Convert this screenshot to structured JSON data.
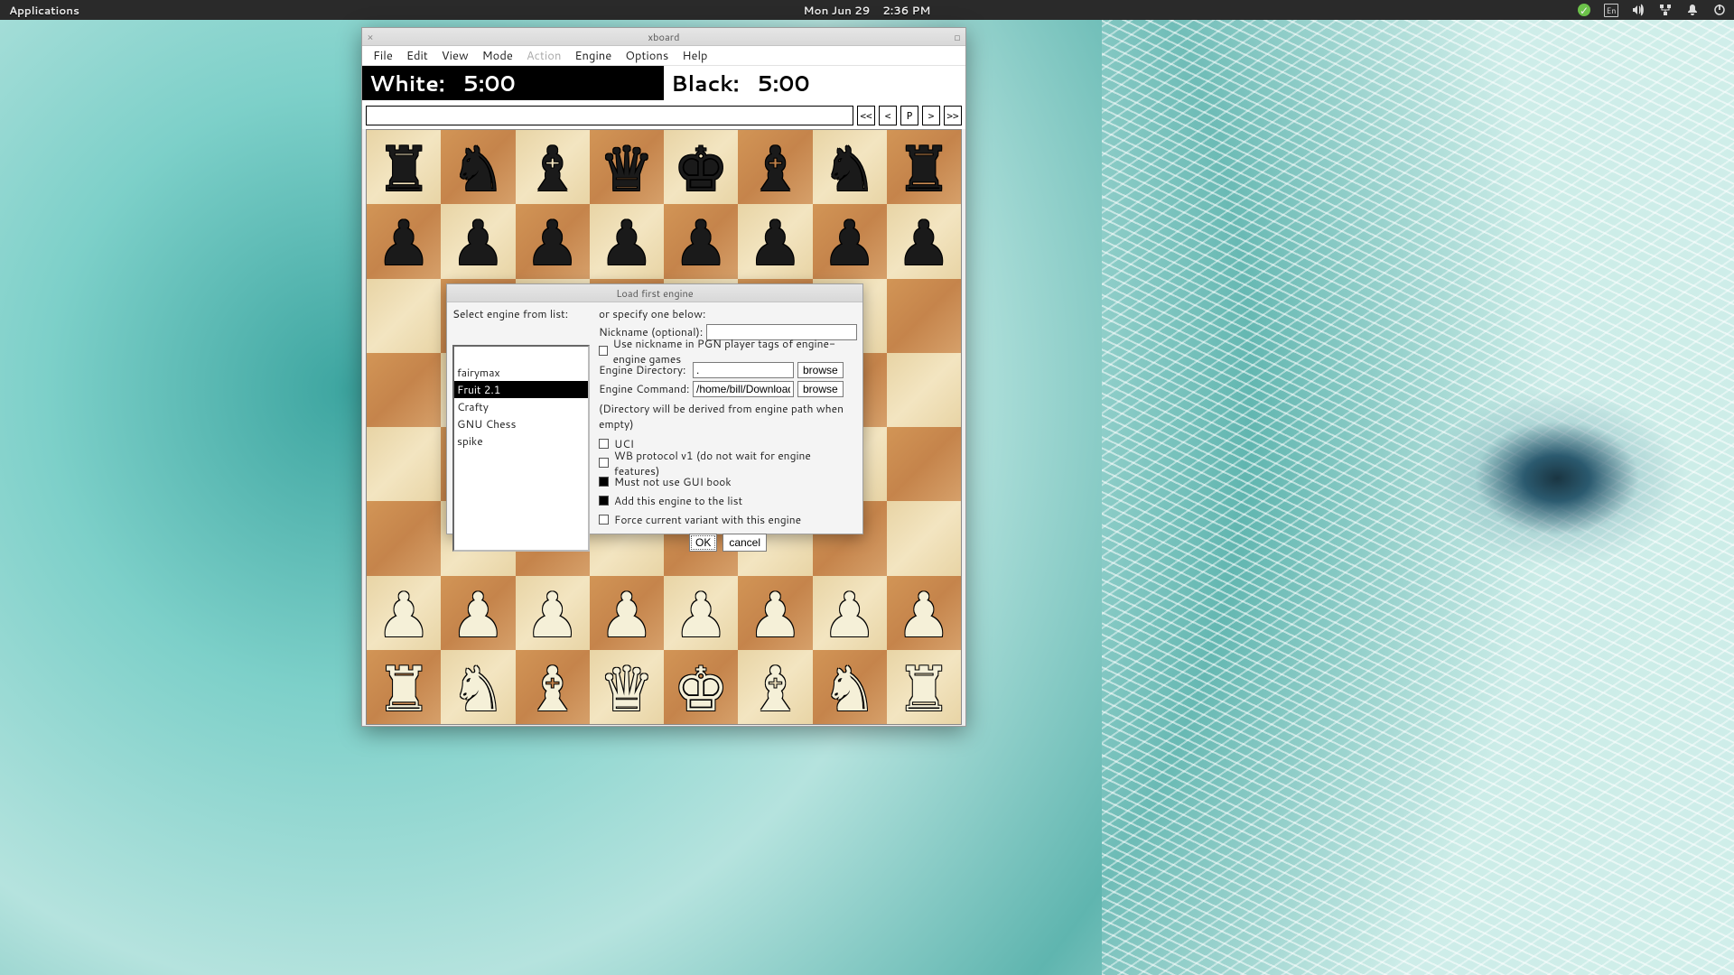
{
  "topbar": {
    "apps": "Applications",
    "date": "Mon Jun 29",
    "time": "2:36 PM",
    "lang": "En"
  },
  "xboard": {
    "title": "xboard",
    "menus": [
      "File",
      "Edit",
      "View",
      "Mode",
      "Action",
      "Engine",
      "Options",
      "Help"
    ],
    "menu_disabled_index": 4,
    "clock_white_label": "White:",
    "clock_white_time": "5:00",
    "clock_black_label": "Black:",
    "clock_black_time": "5:00",
    "nav": [
      "<<",
      "<",
      "P",
      ">",
      ">>"
    ]
  },
  "board": {
    "rows": [
      [
        "bR",
        "bN",
        "bB",
        "bQ",
        "bK",
        "bB",
        "bN",
        "bR"
      ],
      [
        "bP",
        "bP",
        "bP",
        "bP",
        "bP",
        "bP",
        "bP",
        "bP"
      ],
      [
        "",
        "",
        "",
        "",
        "",
        "",
        "",
        ""
      ],
      [
        "",
        "",
        "",
        "",
        "",
        "",
        "",
        ""
      ],
      [
        "",
        "",
        "",
        "",
        "",
        "",
        "",
        ""
      ],
      [
        "",
        "",
        "",
        "",
        "",
        "",
        "",
        ""
      ],
      [
        "wP",
        "wP",
        "wP",
        "wP",
        "wP",
        "wP",
        "wP",
        "wP"
      ],
      [
        "wR",
        "wN",
        "wB",
        "wQ",
        "wK",
        "wB",
        "wN",
        "wR"
      ]
    ],
    "glyphs": {
      "K": "♚",
      "Q": "♛",
      "R": "♜",
      "B": "♝",
      "N": "♞",
      "P": "♟"
    }
  },
  "dialog": {
    "title": "Load first engine",
    "left_label": "Select engine from list:",
    "engines": [
      "fairymax",
      "Fruit 2.1",
      "Crafty",
      "GNU Chess",
      "spike"
    ],
    "selected_engine_index": 1,
    "right_label": "or specify one below:",
    "nickname_label": "Nickname (optional):",
    "nickname_value": "",
    "use_nick_label": "Use nickname in PGN player tags of engine-engine games",
    "use_nick_checked": false,
    "dir_label": "Engine Directory:",
    "dir_value": ".",
    "cmd_label": "Engine Command:",
    "cmd_value": "/home/bill/Downloads/s",
    "browse": "browse",
    "dir_note": "(Directory will be derived from engine path when empty)",
    "uci_label": "UCI",
    "uci_checked": false,
    "wbv1_label": "WB protocol v1 (do not wait for engine features)",
    "wbv1_checked": false,
    "nogui_label": "Must not use GUI book",
    "nogui_checked": true,
    "addlist_label": "Add this engine to the list",
    "addlist_checked": true,
    "forcevar_label": "Force current variant with this engine",
    "forcevar_checked": false,
    "ok": "OK",
    "cancel": "cancel"
  }
}
